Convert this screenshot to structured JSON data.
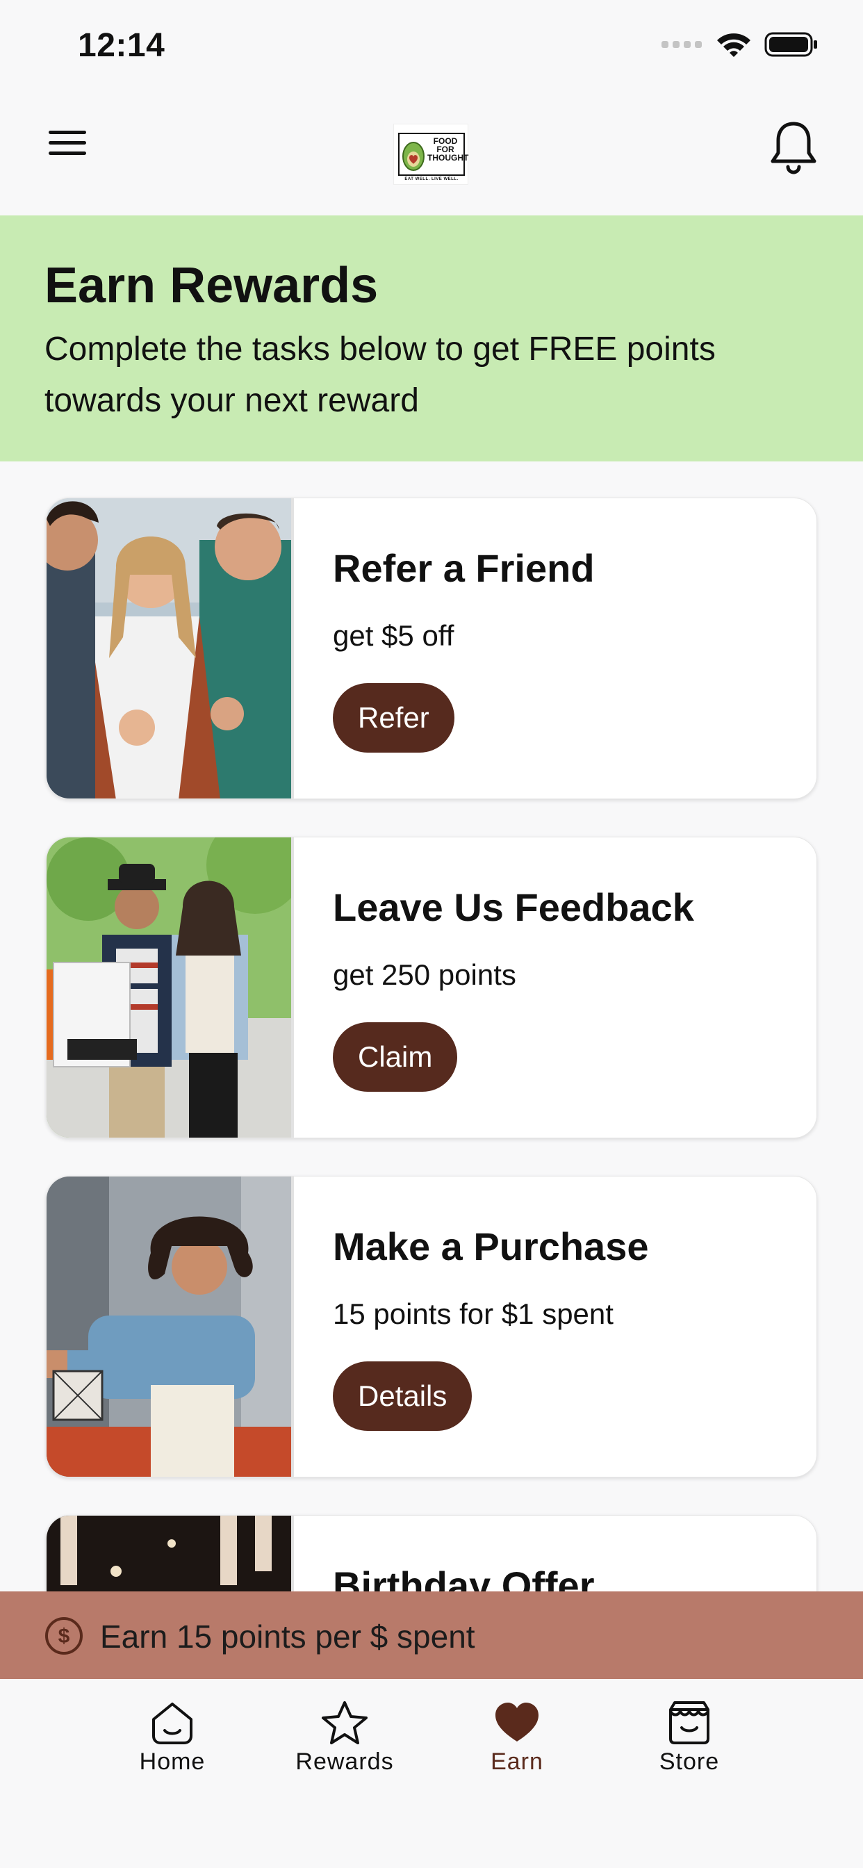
{
  "status_bar": {
    "time": "12:14"
  },
  "header": {
    "logo_text_line1": "FOOD",
    "logo_text_line2": "FOR",
    "logo_text_line3": "THOUGHT",
    "logo_tagline": "EAT WELL. LIVE WELL."
  },
  "hero": {
    "title": "Earn Rewards",
    "subtitle": "Complete the tasks below to get FREE points towards your next reward"
  },
  "cards": [
    {
      "title": "Refer a Friend",
      "subtitle": "get $5 off",
      "button": "Refer"
    },
    {
      "title": "Leave Us Feedback",
      "subtitle": "get 250 points",
      "button": "Claim"
    },
    {
      "title": "Make a Purchase",
      "subtitle": "15 points for $1 spent",
      "button": "Details"
    },
    {
      "title": "Birthday Offer"
    }
  ],
  "earn_banner": {
    "text": "Earn 15 points per $ spent",
    "icon": "dollar-circle-icon"
  },
  "tabs": [
    {
      "label": "Home",
      "icon": "home-icon"
    },
    {
      "label": "Rewards",
      "icon": "star-icon"
    },
    {
      "label": "Earn",
      "icon": "heart-icon",
      "active": true
    },
    {
      "label": "Store",
      "icon": "store-icon"
    }
  ],
  "colors": {
    "hero_bg": "#c8ebb3",
    "button_bg": "#562a1e",
    "banner_bg": "#b87a6a",
    "active_tab": "#5a2a1c"
  }
}
